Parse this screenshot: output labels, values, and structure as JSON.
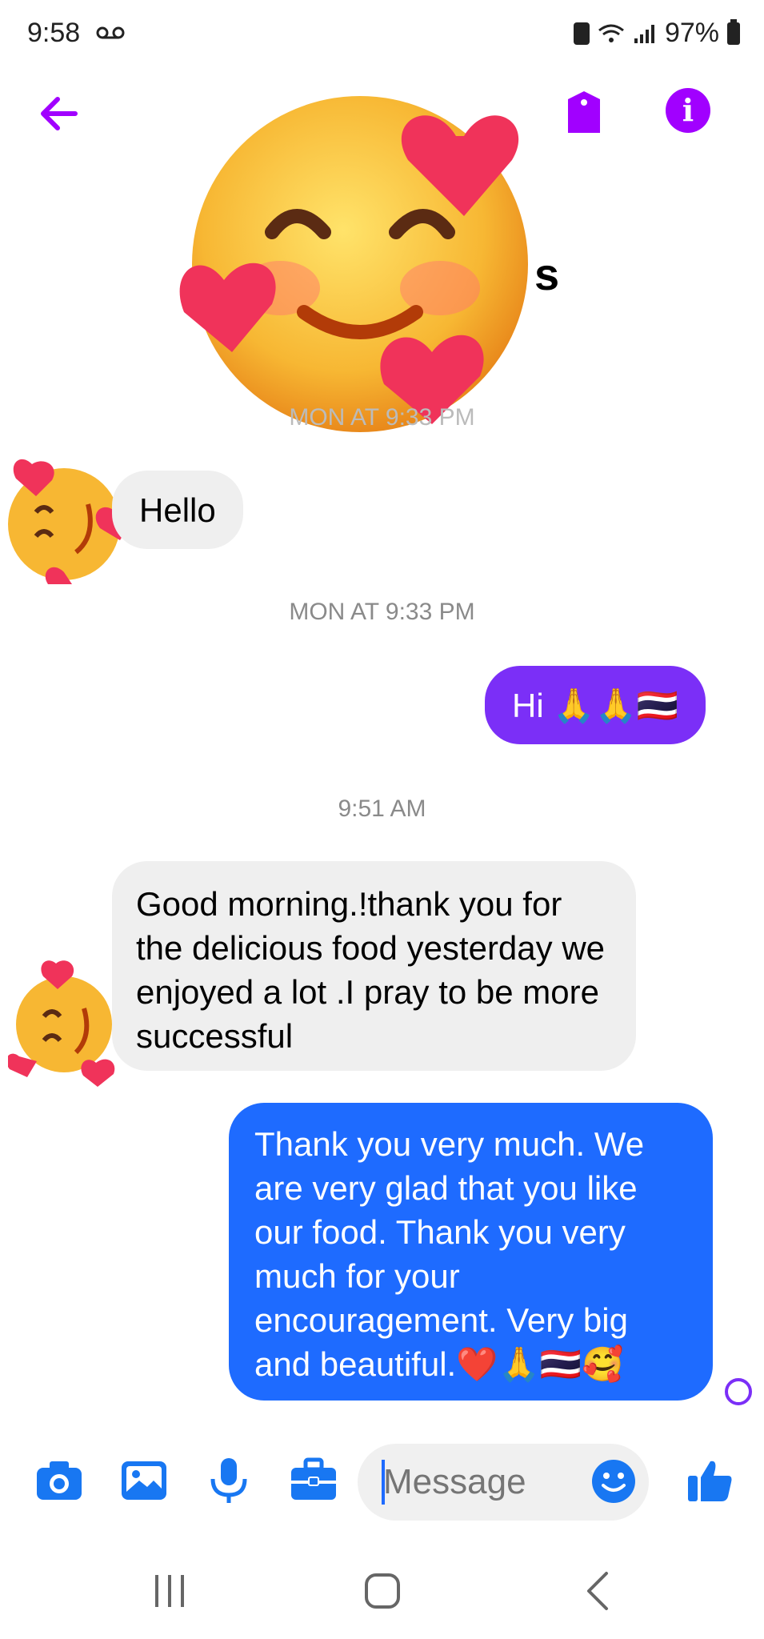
{
  "status_bar": {
    "time": "9:58",
    "battery": "97%"
  },
  "header": {
    "contact_name_visible_part": "s"
  },
  "messages": [
    {
      "timestamp": "MON AT 9:33 PM"
    },
    {
      "incoming_text": "Hello"
    },
    {
      "outgoing_text": "Hi 🙏🙏🇹🇭"
    },
    {
      "timestamp": "9:51 AM"
    },
    {
      "incoming_text": "Good morning.!thank you for the delicious food yesterday we enjoyed a lot .I pray to be more successful"
    },
    {
      "outgoing_text": "Thank you very much. We are very glad that you like our food.  Thank you very much for your encouragement.  Very big and beautiful.❤️🙏🇹🇭🥰"
    }
  ],
  "composer": {
    "placeholder": "Message"
  },
  "colors": {
    "accent_purple": "#a100ff",
    "bubble_purple": "#7b2ff7",
    "bubble_blue": "#1e6bff",
    "icon_blue": "#1877f2"
  },
  "icons": [
    "back-arrow-icon",
    "tag-icon",
    "info-icon",
    "camera-icon",
    "image-icon",
    "microphone-icon",
    "briefcase-icon",
    "emoji-icon",
    "thumbs-up-icon",
    "recents-icon",
    "home-icon",
    "back-icon"
  ]
}
